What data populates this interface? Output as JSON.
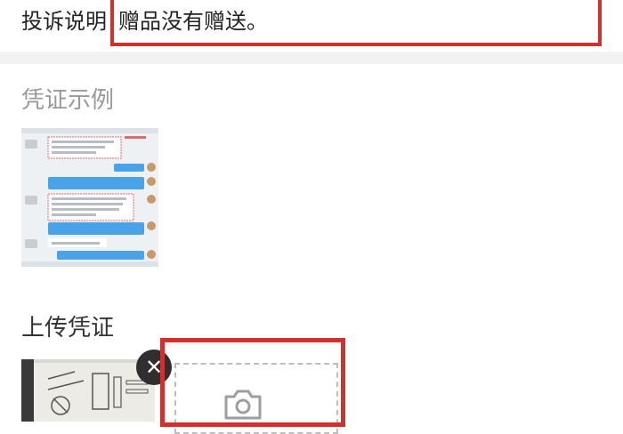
{
  "complaint": {
    "label": "投诉说明：",
    "value": "赠品没有赠送。"
  },
  "evidence_example": {
    "title": "凭证示例",
    "thumbnail": "chat-screenshot-example"
  },
  "upload": {
    "title": "上传凭证",
    "thumbnail": "uploaded-photo",
    "remove_icon": "close-icon",
    "add_icon": "camera-icon"
  },
  "colors": {
    "highlight": "#d32f2f",
    "divider": "#f2f2f2",
    "muted_text": "#9a9a9a"
  }
}
